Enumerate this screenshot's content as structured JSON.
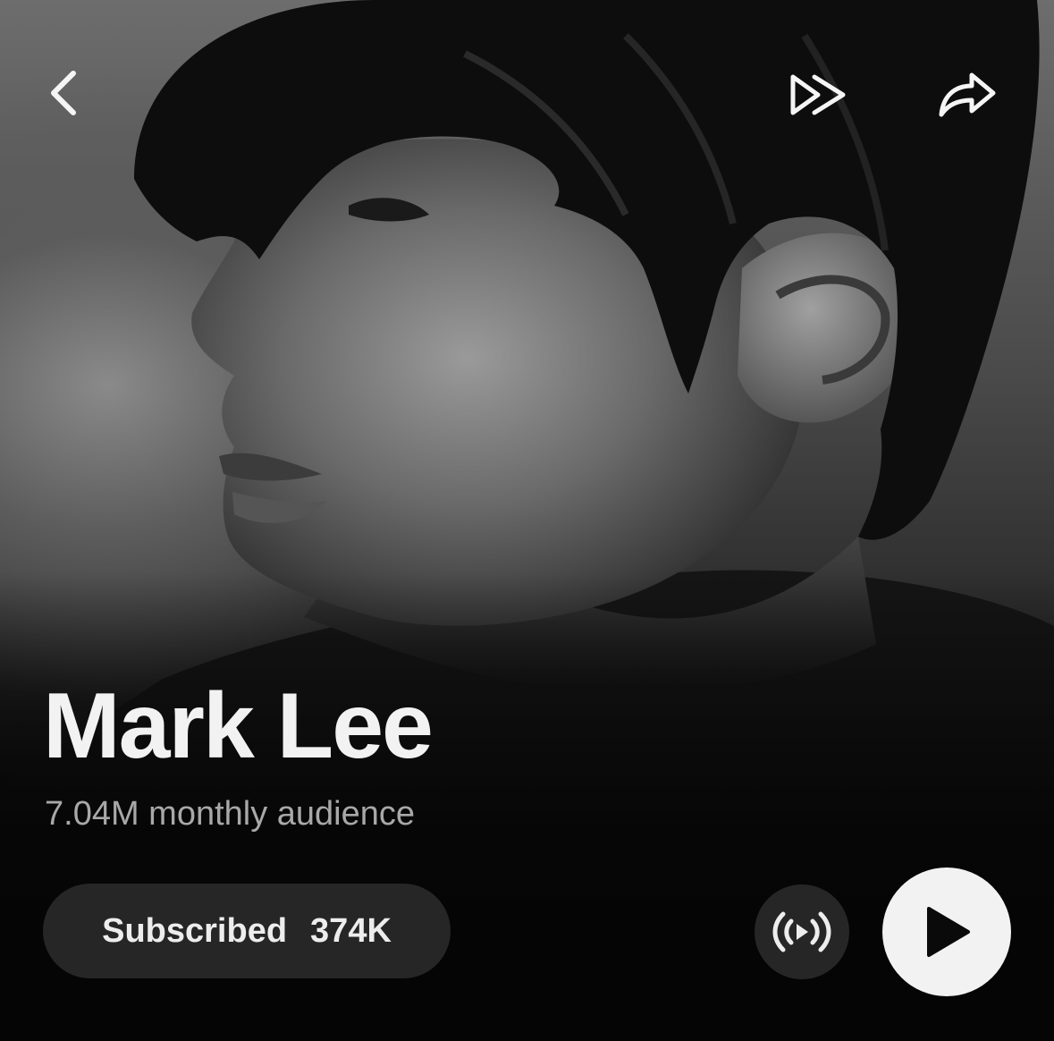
{
  "artist": {
    "name": "Mark Lee",
    "monthly_audience": "7.04M monthly audience"
  },
  "subscribe": {
    "label": "Subscribed",
    "count": "374K"
  },
  "icons": {
    "back": "chevron-left-icon",
    "skip": "double-chevron-right-icon",
    "share": "share-arrow-icon",
    "radio": "radio-broadcast-icon",
    "play": "play-icon"
  },
  "colors": {
    "background": "#050505",
    "text_primary": "#f2f2f2",
    "text_secondary": "#a8a8a8",
    "pill_background": "#262626",
    "play_button": "#f2f2f2"
  }
}
